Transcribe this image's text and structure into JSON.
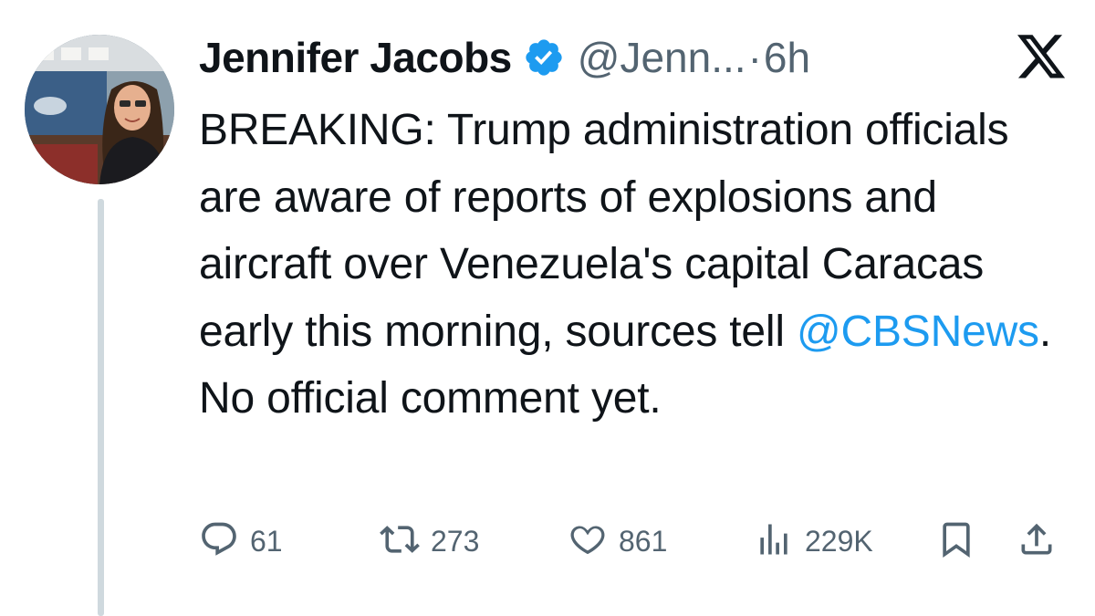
{
  "tweet": {
    "author_name": "Jennifer Jacobs",
    "handle": "@Jenn...",
    "separator": "·",
    "time": "6h",
    "text_before_mention": "BREAKING: Trump administration officials are aware of reports of explosions and aircraft over Venezuela's capital Caracas early this morning, sources tell ",
    "mention": "@CBSNews",
    "text_after_mention": ". No official comment yet.",
    "verified": true
  },
  "stats": {
    "replies": "61",
    "reposts": "273",
    "likes": "861",
    "views": "229K"
  },
  "colors": {
    "accent": "#1d9bf0",
    "secondary_text": "#536471",
    "thread_line": "#cfd9de"
  },
  "icons": {
    "platform": "x-logo-icon",
    "verified": "verified-badge-icon",
    "reply": "reply-icon",
    "repost": "repost-icon",
    "like": "heart-icon",
    "views": "views-icon",
    "bookmark": "bookmark-icon",
    "share": "share-icon"
  }
}
